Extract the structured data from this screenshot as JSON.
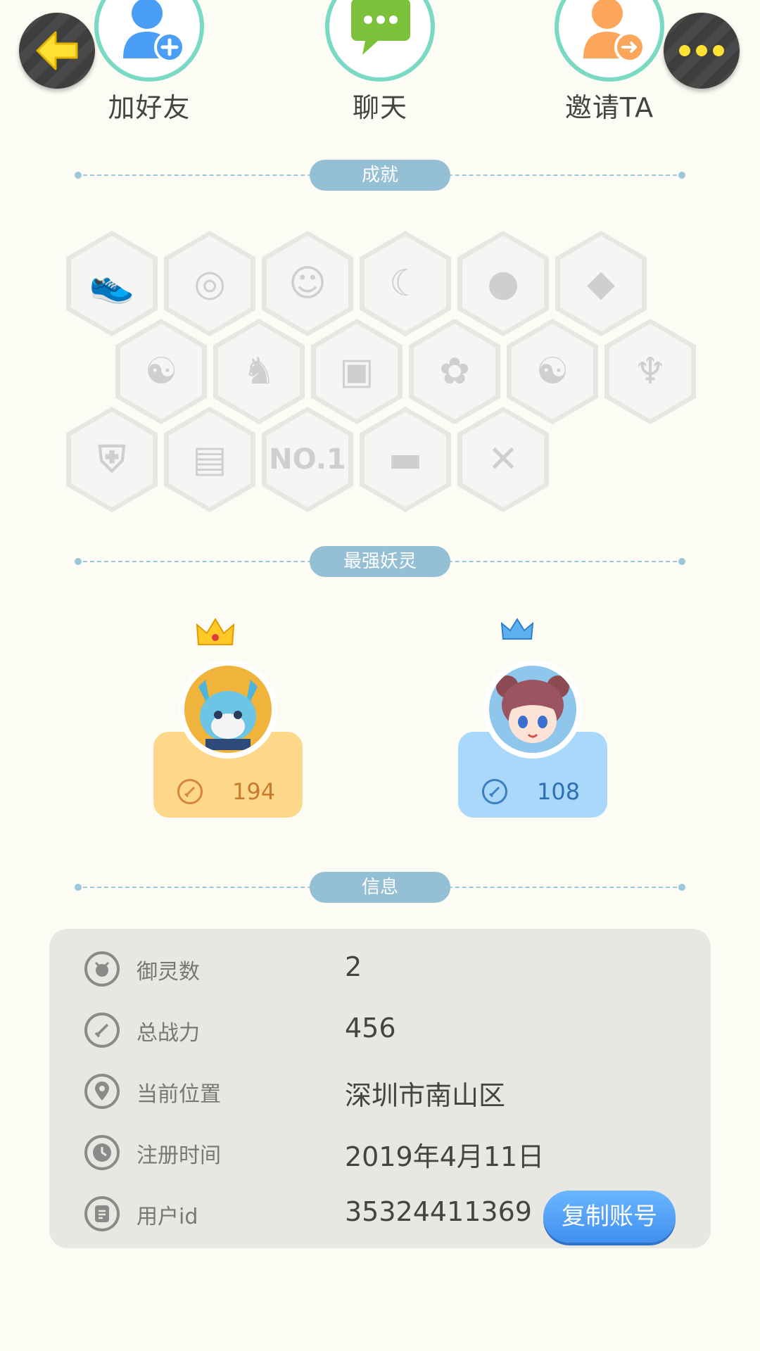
{
  "top_actions": {
    "add_friend": "加好友",
    "chat": "聊天",
    "invite": "邀请TA"
  },
  "sections": {
    "achievements": "成就",
    "strongest_spirits": "最强妖灵",
    "info": "信息"
  },
  "achievements": [
    {
      "icon": "sneaker-icon"
    },
    {
      "icon": "target-icon"
    },
    {
      "icon": "cat-face-icon"
    },
    {
      "icon": "moon-icon"
    },
    {
      "icon": "pearl-icon"
    },
    {
      "icon": "crystal-icon"
    },
    {
      "icon": "yin-yang-comet-icon"
    },
    {
      "icon": "demon-icon"
    },
    {
      "icon": "cart-cat-icon"
    },
    {
      "icon": "fox-balloon-icon"
    },
    {
      "icon": "yin-yang-card-icon"
    },
    {
      "icon": "dragon-icon"
    },
    {
      "icon": "shield-icon"
    },
    {
      "icon": "book-icon"
    },
    {
      "icon": "no1-icon",
      "text": "NO.1"
    },
    {
      "icon": "belt-icon"
    },
    {
      "icon": "crossed-swords-icon"
    }
  ],
  "strongest_spirits": [
    {
      "power": "194",
      "theme": "gold",
      "avatar": "blue-wolf-spirit"
    },
    {
      "power": "108",
      "theme": "blue",
      "avatar": "girl-spirit"
    }
  ],
  "info": {
    "rows": [
      {
        "label": "御灵数",
        "value": "2",
        "icon": "spirit-count-icon"
      },
      {
        "label": "总战力",
        "value": "456",
        "icon": "power-icon"
      },
      {
        "label": "当前位置",
        "value": "深圳市南山区",
        "icon": "location-icon"
      },
      {
        "label": "注册时间",
        "value": "2019年4月11日",
        "icon": "clock-icon"
      },
      {
        "label": "用户id",
        "value": "35324411369",
        "icon": "id-card-icon"
      }
    ],
    "copy_button": "复制账号"
  },
  "colors": {
    "background": "#fcfcf4",
    "section_pill": "#94bfd4",
    "gold_card": "#fdd88a",
    "blue_card": "#a9d8fb",
    "copy_button": "#4a9ef5"
  }
}
